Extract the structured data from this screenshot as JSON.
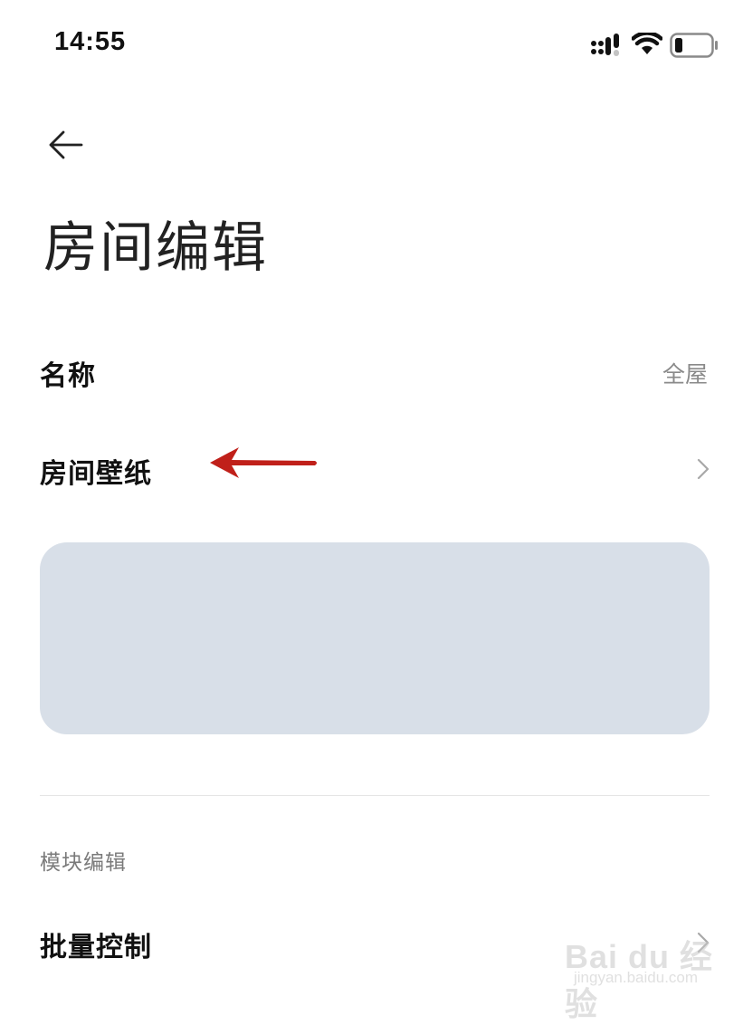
{
  "status_bar": {
    "time": "14:55",
    "icons": [
      "signal-icon",
      "wifi-icon",
      "battery-icon"
    ]
  },
  "header": {
    "back_icon": "arrow-left-icon",
    "title": "房间编辑"
  },
  "rows": {
    "name": {
      "label": "名称",
      "value": "全屋"
    },
    "wallpaper": {
      "label": "房间壁纸",
      "chevron_icon": "chevron-right-icon"
    }
  },
  "wallpaper_preview": {
    "color": "#d8dfe8"
  },
  "annotation": {
    "color": "#c0201a",
    "icon": "red-arrow-annotation"
  },
  "module_section": {
    "header": "模块编辑",
    "items": [
      {
        "label": "批量控制",
        "chevron_icon": "chevron-right-icon"
      }
    ]
  },
  "watermark": {
    "brand": "Bai du 经验",
    "url": "jingyan.baidu.com"
  }
}
